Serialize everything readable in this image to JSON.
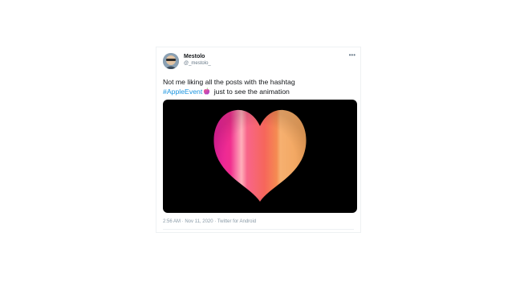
{
  "tweet": {
    "display_name": "Mestolo",
    "handle": "@_mestolo_",
    "more_icon": "more-horizontal-icon",
    "text_line1": "Not me liking all the posts with the hashtag",
    "hashtag": "#AppleEvent",
    "emoji": "apple-logo-emoji",
    "text_line2_rest": " just to see the animation",
    "media": {
      "alt": "heart-animation",
      "background": "#000000"
    },
    "meta": "2:56 AM · Nov 11, 2020 · Twitter for Android"
  },
  "colors": {
    "hashtag": "#1b95e0",
    "name": "#14171a",
    "secondary": "#657786",
    "heart_pink": "#e9249f",
    "heart_coral": "#f7655a",
    "heart_orange": "#f2a055"
  }
}
